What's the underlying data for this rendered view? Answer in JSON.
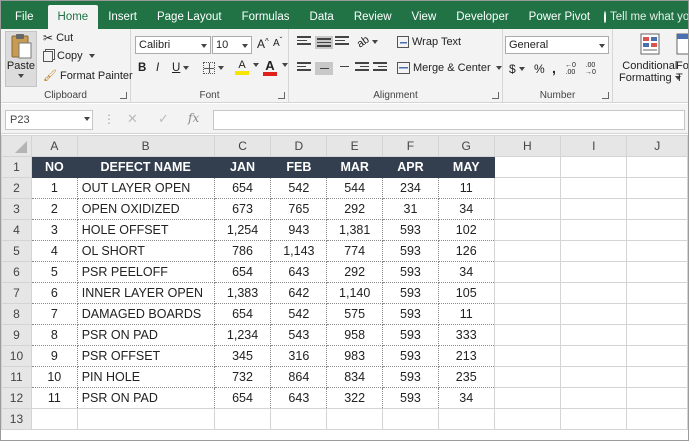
{
  "ribbon_tabs": [
    "File",
    "Home",
    "Insert",
    "Page Layout",
    "Formulas",
    "Data",
    "Review",
    "View",
    "Developer",
    "Power Pivot"
  ],
  "tell_me": "Tell me what you want t",
  "clipboard": {
    "paste": "Paste",
    "cut": "Cut",
    "copy": "Copy",
    "format_painter": "Format Painter",
    "label": "Clipboard"
  },
  "font": {
    "name": "Calibri",
    "size": "10",
    "bold": "B",
    "italic": "I",
    "underline": "U",
    "label": "Font",
    "fill_glyph": "A",
    "color_glyph": "A",
    "grow": "A",
    "shrink": "A"
  },
  "alignment": {
    "wrap_text": "Wrap Text",
    "merge_center": "Merge & Center",
    "label": "Alignment"
  },
  "number": {
    "format": "General",
    "currency": "$",
    "percent": "%",
    "comma": ",",
    "label": "Number"
  },
  "styles": {
    "conditional_formatting_line1": "Conditional",
    "conditional_formatting_line2": "Formatting",
    "format_as_table_line1": "Fo",
    "format_as_table_line2": "T"
  },
  "name_box": "P23",
  "fx": "fx",
  "columns": [
    "A",
    "B",
    "C",
    "D",
    "E",
    "F",
    "G",
    "H",
    "I",
    "J"
  ],
  "rows": [
    "1",
    "2",
    "3",
    "4",
    "5",
    "6",
    "7",
    "8",
    "9",
    "10",
    "11",
    "12",
    "13"
  ],
  "table": {
    "headers": [
      "NO",
      "DEFECT NAME",
      "JAN",
      "FEB",
      "MAR",
      "APR",
      "MAY"
    ],
    "rows": [
      [
        "1",
        "OUT LAYER OPEN",
        "654",
        "542",
        "544",
        "234",
        "11"
      ],
      [
        "2",
        "OPEN OXIDIZED",
        "673",
        "765",
        "292",
        "31",
        "34"
      ],
      [
        "3",
        "HOLE OFFSET",
        "1,254",
        "943",
        "1,381",
        "593",
        "102"
      ],
      [
        "4",
        "OL SHORT",
        "786",
        "1,143",
        "774",
        "593",
        "126"
      ],
      [
        "5",
        "PSR PEELOFF",
        "654",
        "643",
        "292",
        "593",
        "34"
      ],
      [
        "6",
        "INNER LAYER OPEN",
        "1,383",
        "642",
        "1,140",
        "593",
        "105"
      ],
      [
        "7",
        "DAMAGED BOARDS",
        "654",
        "542",
        "575",
        "593",
        "11"
      ],
      [
        "8",
        "PSR ON PAD",
        "1,234",
        "543",
        "958",
        "593",
        "333"
      ],
      [
        "9",
        "PSR OFFSET",
        "345",
        "316",
        "983",
        "593",
        "213"
      ],
      [
        "10",
        "PIN HOLE",
        "732",
        "864",
        "834",
        "593",
        "235"
      ],
      [
        "11",
        "PSR ON PAD",
        "654",
        "643",
        "322",
        "593",
        "34"
      ]
    ]
  },
  "colors": {
    "excel_green": "#217346",
    "header_fill": "#333f4f",
    "font_red": "#e0201b",
    "fill_yellow": "#f7e400"
  }
}
